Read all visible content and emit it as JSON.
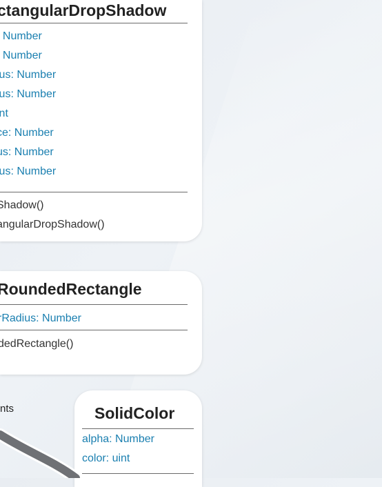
{
  "box1": {
    "title": "ctangularDropShadow",
    "attributes": [
      ": Number",
      ": Number",
      "ius: Number",
      "ius: Number",
      " int",
      "ce: Number",
      "us: Number",
      "ius: Number"
    ],
    "methods": [
      "Shadow()",
      "angularDropShadow()"
    ]
  },
  "box2": {
    "title": "RoundedRectangle",
    "attributes": [
      "rRadius: Number"
    ],
    "methods": [
      "dedRectangle()"
    ]
  },
  "box3": {
    "title": "SolidColor",
    "attributes": [
      "alpha: Number",
      "color: uint"
    ]
  },
  "label": "nts",
  "colors": {
    "attribute": "#1a7fb0",
    "method": "#333333",
    "title": "#222222",
    "arc": "#6f7175"
  }
}
